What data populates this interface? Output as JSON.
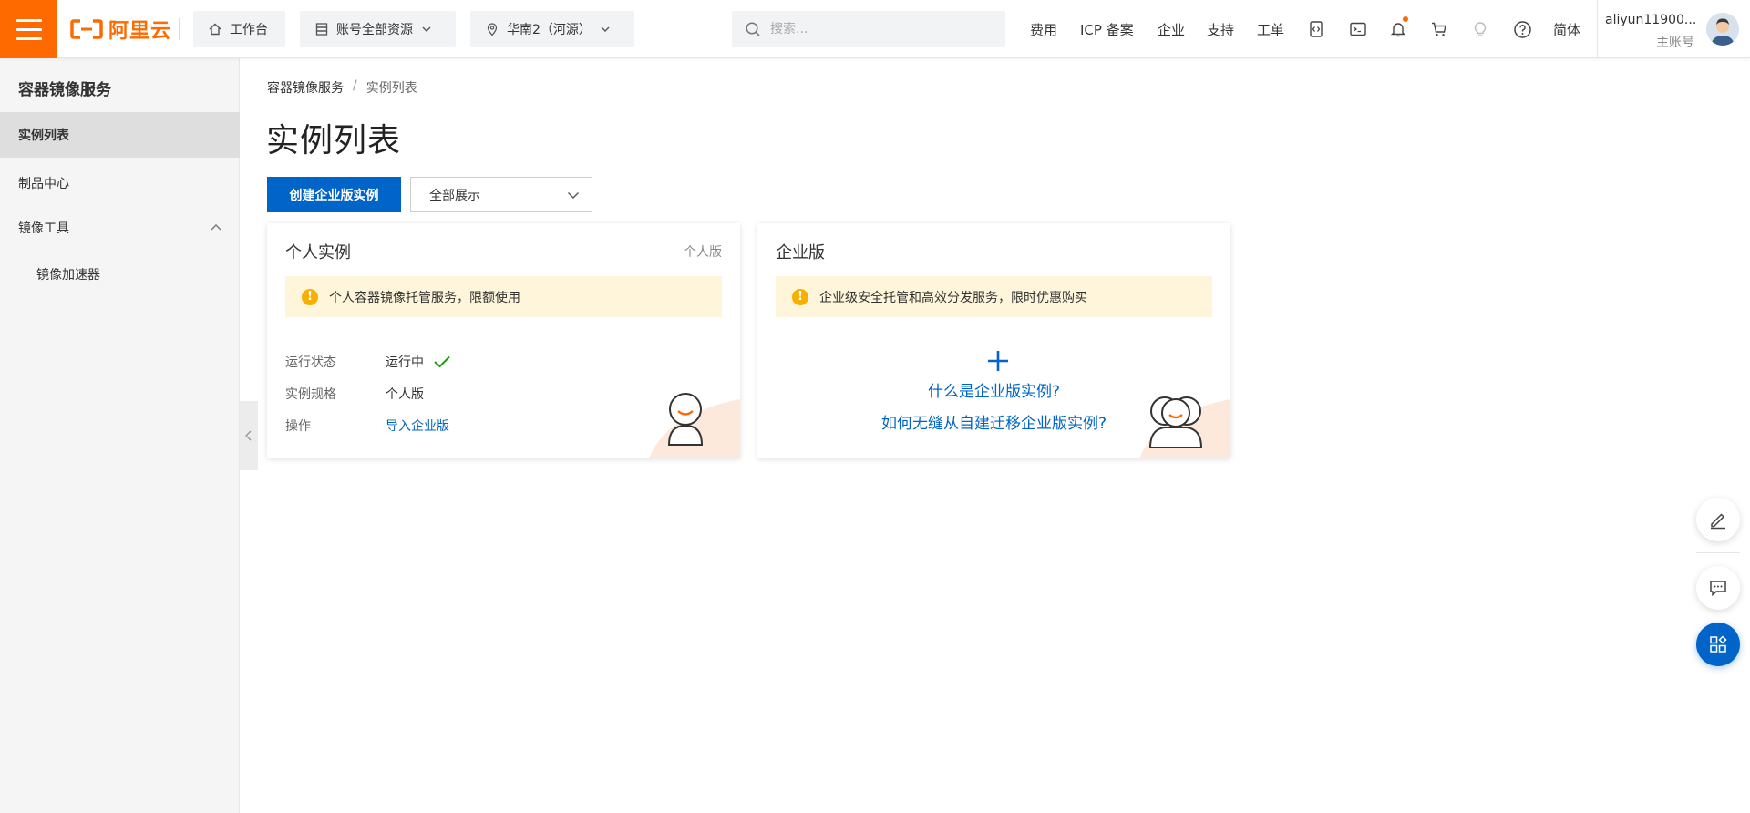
{
  "topbar": {
    "brand": "阿里云",
    "workbench": "工作台",
    "resource_scope": "账号全部资源",
    "region": "华南2（河源）",
    "search_placeholder": "搜索...",
    "links": {
      "fee": "费用",
      "icp": "ICP 备案",
      "enterprise": "企业",
      "support": "支持",
      "ticket": "工单",
      "language": "简体"
    },
    "user": {
      "name": "aliyun11900...",
      "role": "主账号"
    },
    "accent": "#ff6a00"
  },
  "sidebar": {
    "title": "容器镜像服务",
    "items": [
      {
        "label": "实例列表",
        "active": true
      },
      {
        "label": "制品中心"
      },
      {
        "label": "镜像工具",
        "expanded": true
      },
      {
        "label": "镜像加速器"
      }
    ]
  },
  "breadcrumb": {
    "root": "容器镜像服务",
    "separator": "/",
    "current": "实例列表"
  },
  "page": {
    "title": "实例列表",
    "create_button": "创建企业版实例",
    "filter_value": "全部展示"
  },
  "personal_card": {
    "title": "个人实例",
    "tag": "个人版",
    "notice": "个人容器镜像托管服务，限额使用",
    "status_label": "运行状态",
    "status_value": "运行中",
    "spec_label": "实例规格",
    "spec_value": "个人版",
    "action_label": "操作",
    "action_link": "导入企业版"
  },
  "enterprise_card": {
    "title": "企业版",
    "notice": "企业级安全托管和高效分发服务，限时优惠购买",
    "link_what": "什么是企业版实例?",
    "link_migrate": "如何无缝从自建迁移企业版实例?"
  },
  "colors": {
    "primary": "#0064c8",
    "warning": "#f7b000",
    "success": "#1fa00a"
  }
}
